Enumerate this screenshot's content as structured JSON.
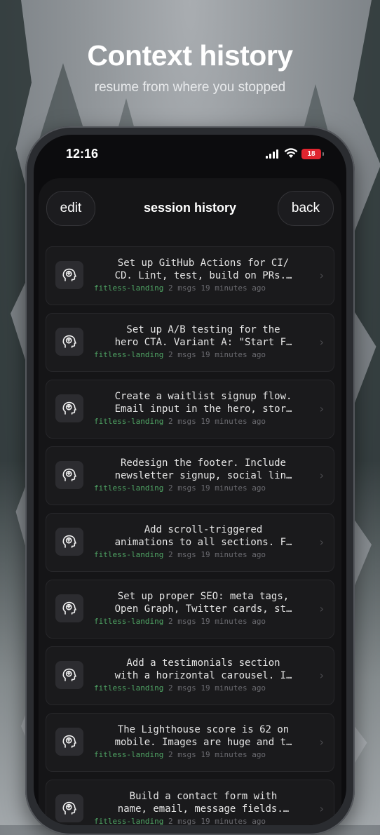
{
  "hero": {
    "title": "Context history",
    "subtitle": "resume from where you stopped"
  },
  "status_bar": {
    "time": "12:16",
    "battery": "18"
  },
  "header": {
    "edit_label": "edit",
    "title": "session history",
    "back_label": "back"
  },
  "colors": {
    "project_tag": "#4fa464",
    "battery_low": "#e0252f"
  },
  "sessions": [
    {
      "line1": "Set up GitHub Actions for CI/",
      "line2": "CD. Lint, test, build on PRs.…",
      "project": "fitless-landing",
      "msgs": "2 msgs",
      "time": "19 minutes ago"
    },
    {
      "line1": "Set up A/B testing for the",
      "line2": "hero CTA. Variant A: \"Start F…",
      "project": "fitless-landing",
      "msgs": "2 msgs",
      "time": "19 minutes ago"
    },
    {
      "line1": "Create a waitlist signup flow.",
      "line2": "Email input in the hero, stor…",
      "project": "fitless-landing",
      "msgs": "2 msgs",
      "time": "19 minutes ago"
    },
    {
      "line1": "Redesign the footer. Include",
      "line2": "newsletter signup, social lin…",
      "project": "fitless-landing",
      "msgs": "2 msgs",
      "time": "19 minutes ago"
    },
    {
      "line1": "Add scroll-triggered",
      "line2": "animations to all sections. F…",
      "project": "fitless-landing",
      "msgs": "2 msgs",
      "time": "19 minutes ago"
    },
    {
      "line1": "Set up proper SEO: meta tags,",
      "line2": "Open Graph, Twitter cards, st…",
      "project": "fitless-landing",
      "msgs": "2 msgs",
      "time": "19 minutes ago"
    },
    {
      "line1": "Add a testimonials section",
      "line2": "with a horizontal carousel. I…",
      "project": "fitless-landing",
      "msgs": "2 msgs",
      "time": "19 minutes ago"
    },
    {
      "line1": "The Lighthouse score is 62 on",
      "line2": "mobile. Images are huge and t…",
      "project": "fitless-landing",
      "msgs": "2 msgs",
      "time": "19 minutes ago"
    },
    {
      "line1": "Build a contact form with",
      "line2": "name, email, message fields.…",
      "project": "fitless-landing",
      "msgs": "2 msgs",
      "time": "19 minutes ago"
    }
  ]
}
